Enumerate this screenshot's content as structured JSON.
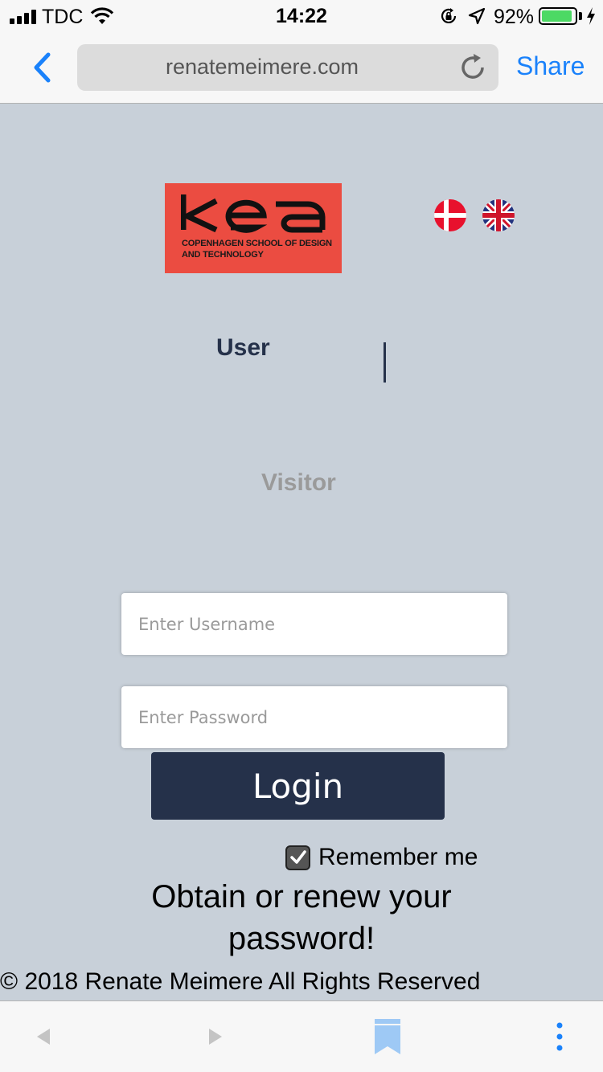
{
  "status_bar": {
    "carrier": "TDC",
    "time": "14:22",
    "battery_percent": "92%",
    "battery_level": 0.92,
    "icons": [
      "signal-icon",
      "wifi-icon",
      "rotation-lock-icon",
      "location-icon",
      "battery-icon",
      "charging-icon"
    ]
  },
  "browser": {
    "url": "renatemeimere.com",
    "share_label": "Share",
    "icons": [
      "back-chevron-icon",
      "reload-icon"
    ]
  },
  "logo": {
    "wordmark": "kea",
    "tagline_line1": "COPENHAGEN SCHOOL OF DESIGN",
    "tagline_line2": "AND TECHNOLOGY"
  },
  "languages": [
    "danish-flag-icon",
    "uk-flag-icon"
  ],
  "tabs": {
    "user": "User",
    "visitor": "Visitor",
    "active": "user"
  },
  "form": {
    "username_placeholder": "Enter Username",
    "username_value": "",
    "password_placeholder": "Enter Password",
    "password_value": "",
    "login_label": "Login",
    "remember_label": "Remember me",
    "remember_checked": true,
    "obtain_line1": "Obtain or renew your",
    "obtain_line2": "password!"
  },
  "footer": {
    "copyright": "© 2018 Renate Meimere All Rights Reserved"
  },
  "toolbar": {
    "icons": [
      "back-arrow-icon",
      "forward-arrow-icon",
      "bookmark-icon",
      "more-icon"
    ]
  },
  "colors": {
    "page_bg": "#c8d0d9",
    "navy": "#25314a",
    "kea_red": "#eb4c41",
    "ios_blue": "#1a82fb",
    "battery_green": "#4cd964"
  }
}
